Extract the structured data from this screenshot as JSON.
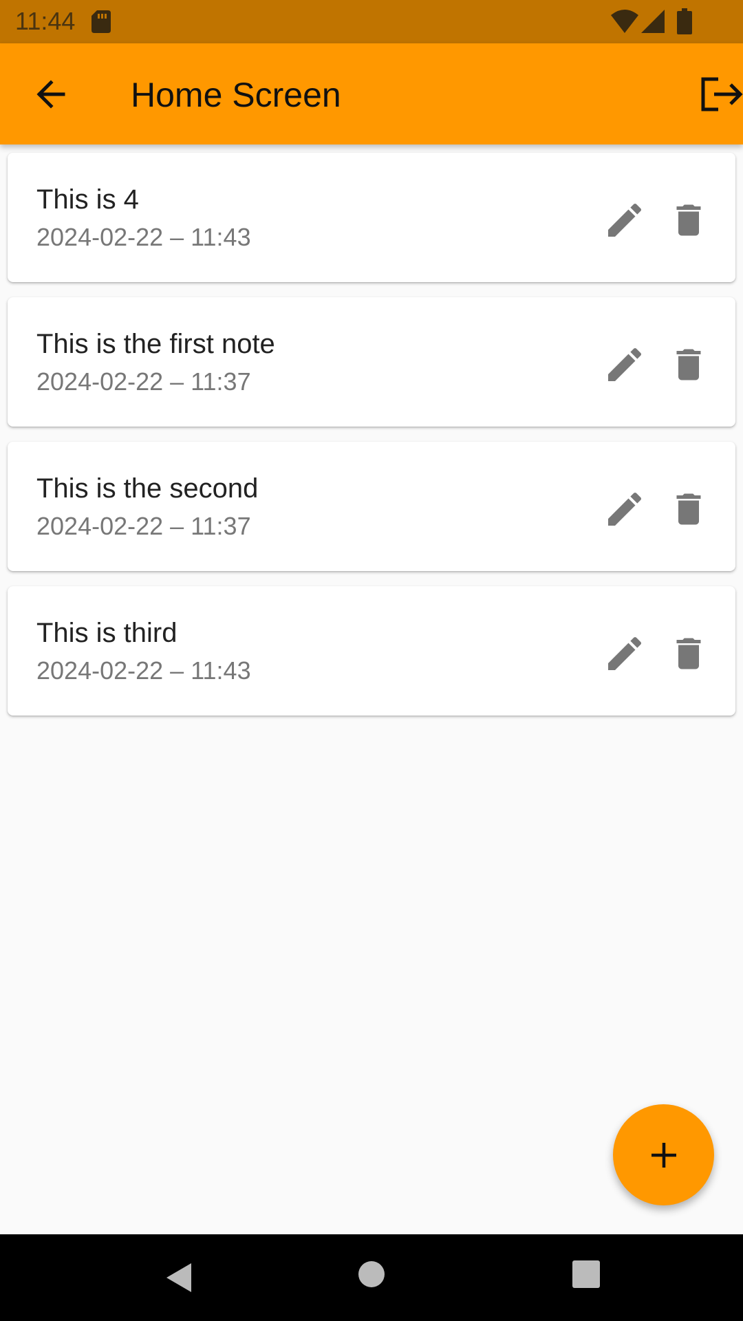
{
  "status_bar": {
    "time": "11:44",
    "icons": [
      "sd-card-icon",
      "wifi-icon",
      "signal-icon",
      "battery-icon"
    ]
  },
  "app_bar": {
    "title": "Home Screen",
    "back_icon": "arrow-back-icon",
    "logout_icon": "logout-icon",
    "background": "#ff9800"
  },
  "notes": [
    {
      "title": "This is 4",
      "date": "2024-02-22 – 11:43"
    },
    {
      "title": "This is the first note",
      "date": "2024-02-22 – 11:37"
    },
    {
      "title": "This is the second",
      "date": "2024-02-22 – 11:37"
    },
    {
      "title": "This is third",
      "date": "2024-02-22 – 11:43"
    }
  ],
  "note_actions": {
    "edit_icon": "pencil-icon",
    "delete_icon": "trash-icon"
  },
  "fab": {
    "icon": "plus-icon",
    "color": "#ff9800"
  },
  "nav_bar": {
    "icons": [
      "nav-back-icon",
      "nav-home-icon",
      "nav-recents-icon"
    ]
  }
}
